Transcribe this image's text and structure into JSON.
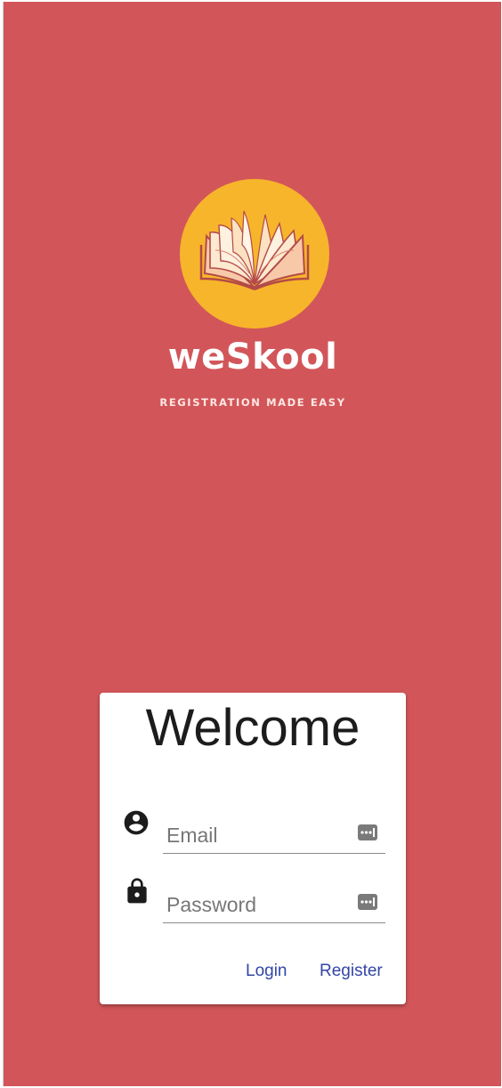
{
  "brand": {
    "name": "weSkool",
    "tagline": "REGISTRATION MADE EASY",
    "logo_icon": "open-book-icon",
    "logo_color": "#f7b52b"
  },
  "background_color": "#d25659",
  "login_card": {
    "title": "Welcome",
    "email": {
      "placeholder": "Email",
      "value": "",
      "icon": "account-circle-icon"
    },
    "password": {
      "placeholder": "Password",
      "value": "",
      "icon": "lock-icon"
    },
    "login_label": "Login",
    "register_label": "Register",
    "button_color": "#3346a6"
  }
}
